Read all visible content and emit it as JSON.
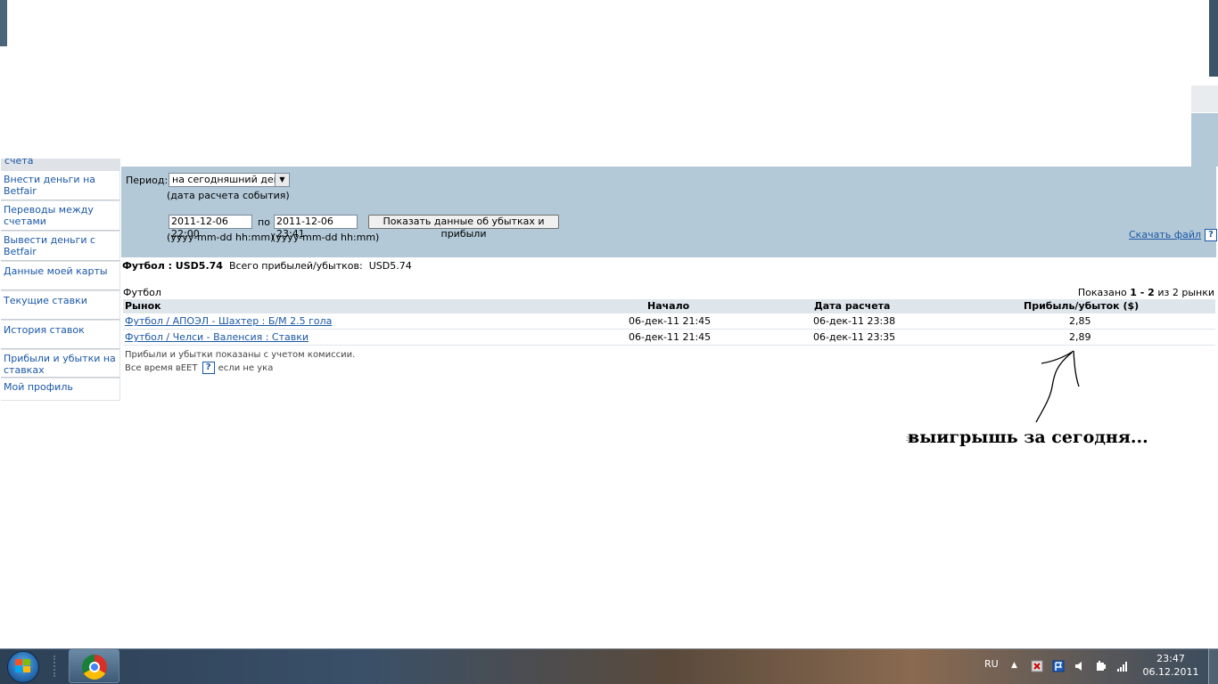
{
  "sidebar": {
    "cut_label": "счета",
    "items": [
      {
        "label": "Внести деньги на Betfair"
      },
      {
        "label": "Переводы между счетами"
      },
      {
        "label": "Вывести деньги с Betfair"
      },
      {
        "label": "Данные моей карты"
      },
      {
        "label": "Текущие ставки"
      },
      {
        "label": "История ставок"
      },
      {
        "label": "Прибыли и убытки на ставках"
      },
      {
        "label": "Мой профиль"
      }
    ]
  },
  "filter": {
    "period_label": "Период:",
    "period_value": "на сегодняшний день",
    "period_hint": "(дата расчета события)",
    "from_value": "2011-12-06 22:00",
    "to_label": "по",
    "to_value": "2011-12-06 23:41",
    "from_hint": "(yyyy-mm-dd hh:mm)",
    "to_hint": "(yyyy-mm-dd hh:mm)",
    "show_button": "Показать данные об убытках и прибыли",
    "download_label": "Скачать файл",
    "help_label": "?"
  },
  "summary": {
    "sport_bold": "Футбол : USD5.74",
    "total_label": "Всего прибылей/убытков:",
    "total_value": "USD5.74"
  },
  "section": {
    "sport": "Футбол",
    "paging_prefix": "Показано",
    "paging_range": "1 - 2",
    "paging_suffix": "из 2 рынки"
  },
  "table": {
    "headers": {
      "market": "Рынок",
      "start": "Начало",
      "settled": "Дата расчета",
      "pl": "Прибыль/убыток ($)"
    },
    "rows": [
      {
        "market": "Футбол / АПОЭЛ - Шахтер : Б/М 2.5 гола",
        "start": "06-дек-11 21:45",
        "settled": "06-дек-11 23:38",
        "pl": "2,85"
      },
      {
        "market": "Футбол / Челси - Валенсия : Ставки",
        "start": "06-дек-11 21:45",
        "settled": "06-дек-11 23:35",
        "pl": "2,89"
      }
    ]
  },
  "notes": {
    "commission": "Прибыли и убытки показаны с учетом комиссии.",
    "time_prefix": "Все время в",
    "time_zone": "EET",
    "time_suffix": "если не указ"
  },
  "annotation": {
    "text": "выигрышь за сегодня...",
    "ghost": "за"
  },
  "taskbar": {
    "lang": "RU",
    "time": "23:47",
    "date": "06.12.2011",
    "tray_icons": [
      "network-close-icon",
      "flag-icon",
      "volume-icon",
      "power-icon",
      "signal-icon"
    ]
  },
  "colors": {
    "link": "#1a57a6",
    "filter_bg": "#b3c9d7",
    "header_bg": "#dfe6eb"
  }
}
